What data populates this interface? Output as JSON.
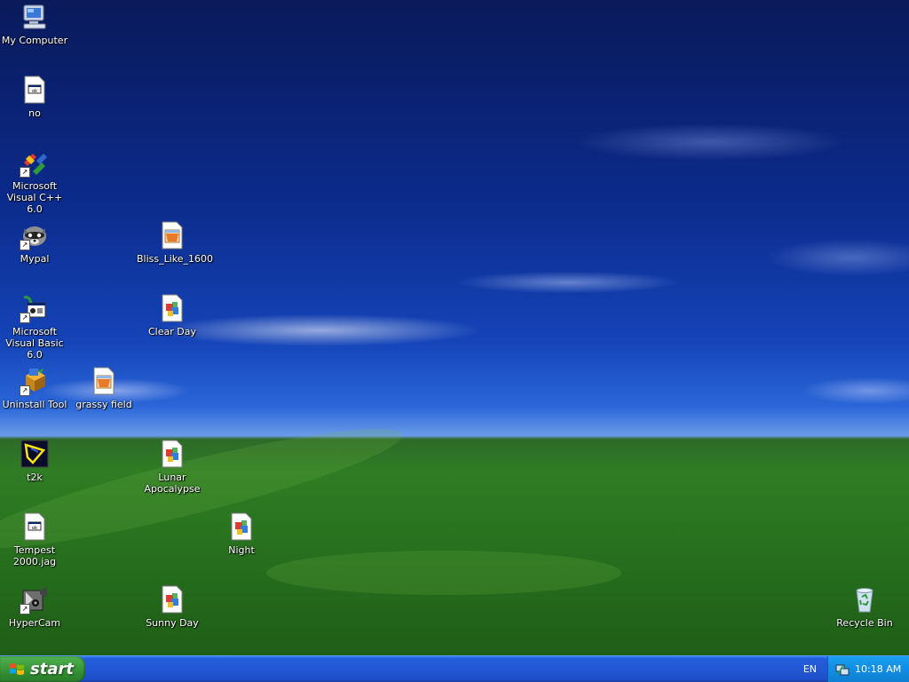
{
  "desktop": {
    "icons": [
      {
        "label": "My Computer",
        "icon": "my-computer-icon"
      },
      {
        "label": "no",
        "icon": "jag-file-icon"
      },
      {
        "label": "Microsoft Visual C++ 6.0",
        "icon": "visual-cpp-icon"
      },
      {
        "label": "Mypal",
        "icon": "mypal-icon"
      },
      {
        "label": "Bliss_Like_1600",
        "icon": "image-file-icon"
      },
      {
        "label": "Microsoft Visual Basic 6.0",
        "icon": "visual-basic-icon"
      },
      {
        "label": "Clear Day",
        "icon": "theme-file-icon"
      },
      {
        "label": "Uninstall Tool",
        "icon": "uninstall-tool-icon"
      },
      {
        "label": "grassy field",
        "icon": "image-file-icon"
      },
      {
        "label": "t2k",
        "icon": "t2k-icon"
      },
      {
        "label": "Lunar Apocalypse",
        "icon": "theme-file-icon"
      },
      {
        "label": "Tempest 2000.jag",
        "icon": "jag-file-icon"
      },
      {
        "label": "Night",
        "icon": "theme-file-icon"
      },
      {
        "label": "HyperCam",
        "icon": "hypercam-icon"
      },
      {
        "label": "Sunny Day",
        "icon": "theme-file-icon"
      },
      {
        "label": "Recycle Bin",
        "icon": "recycle-bin-icon"
      }
    ]
  },
  "taskbar": {
    "start_label": "start",
    "language": "EN",
    "clock": "10:18 AM"
  },
  "colors": {
    "taskbar": "#245ddb",
    "start_button": "#3c9a3c",
    "tray": "#128ee3"
  }
}
